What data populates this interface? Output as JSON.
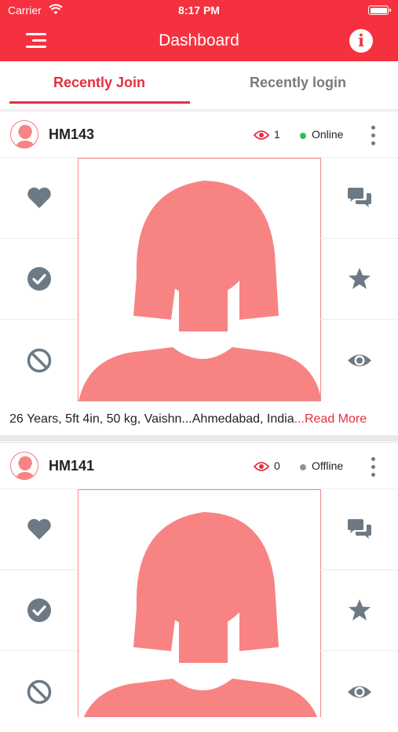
{
  "status_bar": {
    "carrier": "Carrier",
    "time": "8:17 PM"
  },
  "nav": {
    "title": "Dashboard",
    "menu_icon": "menu-icon",
    "info_icon": "info-icon",
    "info_glyph": "i"
  },
  "tabs": [
    {
      "label": "Recently Join",
      "active": true
    },
    {
      "label": "Recently login",
      "active": false
    }
  ],
  "colors": {
    "primary": "#f6313f",
    "accent": "#e52f3e",
    "icon_gray": "#6d7a85",
    "online": "#2fbf5f",
    "offline": "#8a96a0",
    "avatar": "#f88383"
  },
  "profiles": [
    {
      "id": "HM143",
      "views": "1",
      "status": "Online",
      "details": "26 Years, 5ft 4in, 50 kg, Vaishn...Ahmedabad, India",
      "read_more": "...Read More"
    },
    {
      "id": "HM141",
      "views": "0",
      "status": "Offline",
      "details": "",
      "read_more": ""
    }
  ],
  "actions_left": [
    "heart-icon",
    "check-circle-icon",
    "block-icon"
  ],
  "actions_right": [
    "chat-icon",
    "star-icon",
    "eye-icon"
  ]
}
